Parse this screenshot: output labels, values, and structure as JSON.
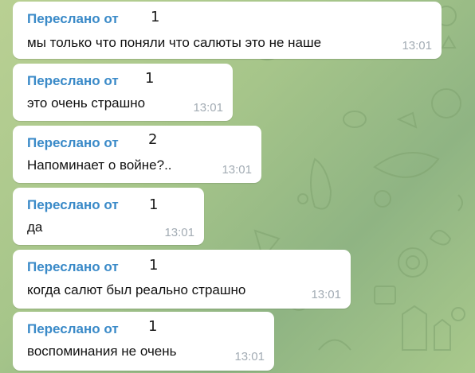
{
  "theme": {
    "background": "#a8c68a",
    "bubble_color": "#ffffff",
    "forward_label_color": "#3a8ac8",
    "timestamp_color": "#a3acb4"
  },
  "messages": [
    {
      "forwarded_label": "Переслано от",
      "forward_count": "1",
      "text": "мы только что поняли что салюты это не наше",
      "time": "13:01"
    },
    {
      "forwarded_label": "Переслано от",
      "forward_count": "1",
      "text": "это очень страшно",
      "time": "13:01"
    },
    {
      "forwarded_label": "Переслано от",
      "forward_count": "2",
      "text": "Напоминает о войне?..",
      "time": "13:01"
    },
    {
      "forwarded_label": "Переслано от",
      "forward_count": "1",
      "text": "да",
      "time": "13:01"
    },
    {
      "forwarded_label": "Переслано от",
      "forward_count": "1",
      "text": "когда салют был реально страшно",
      "time": "13:01"
    },
    {
      "forwarded_label": "Переслано от",
      "forward_count": "1",
      "text": "воспоминания не очень",
      "time": "13:01"
    }
  ]
}
